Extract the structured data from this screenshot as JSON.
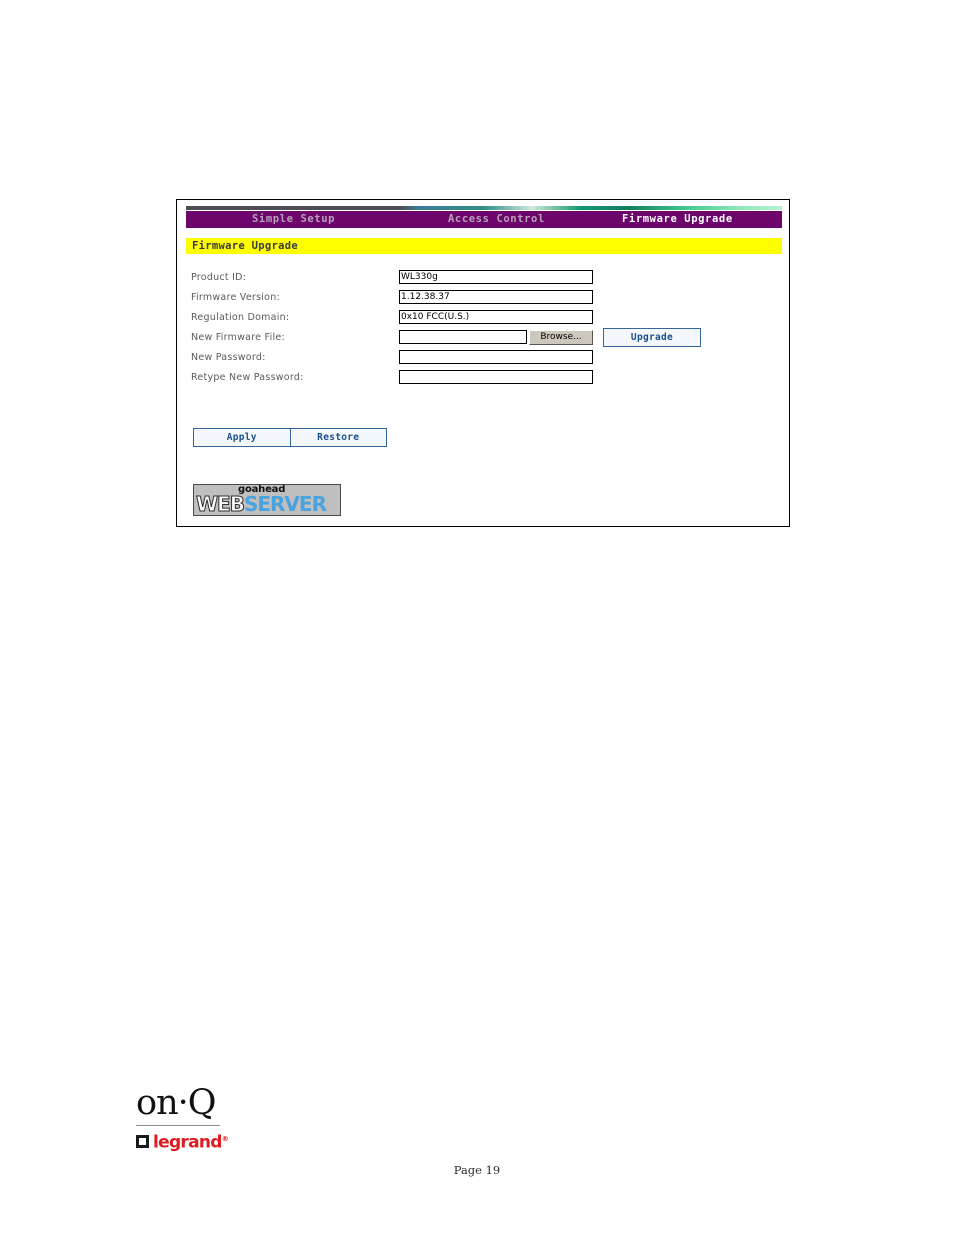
{
  "document": {
    "page_label": "Page 19",
    "brand": {
      "primary": "on·Q",
      "secondary": "legrand",
      "trademark": "®"
    }
  },
  "router_ui": {
    "nav": {
      "items": [
        {
          "label": "Simple Setup",
          "active": false
        },
        {
          "label": "Access Control",
          "active": false
        },
        {
          "label": "Firmware Upgrade",
          "active": true
        }
      ]
    },
    "section": {
      "title": "Firmware Upgrade"
    },
    "form": {
      "rows": [
        {
          "label": "Product ID:",
          "value": "WL330g",
          "placeholder": ""
        },
        {
          "label": "Firmware Version:",
          "value": "1.12.38.37",
          "placeholder": ""
        },
        {
          "label": "Regulation Domain:",
          "value": "0x10 FCC(U.S.)",
          "placeholder": ""
        },
        {
          "label": "New Firmware File:",
          "value": "",
          "placeholder": ""
        },
        {
          "label": "New Password:",
          "value": "",
          "placeholder": ""
        },
        {
          "label": "Retype New Password:",
          "value": "",
          "placeholder": ""
        }
      ],
      "browse_label": "Browse...",
      "upgrade_label": "Upgrade"
    },
    "actions": {
      "apply_label": "Apply",
      "restore_label": "Restore"
    },
    "footer_logo": {
      "top_text": "goahead",
      "main_text_1": "WEB",
      "main_text_2": "SERVER"
    },
    "colors": {
      "nav_bar": "#6c066c",
      "section_bar": "#ffff00",
      "button_border": "#33669b",
      "button_text": "#1b4f8c",
      "logo_blue": "#4aa3df",
      "legrand_red": "#e01b22"
    }
  }
}
